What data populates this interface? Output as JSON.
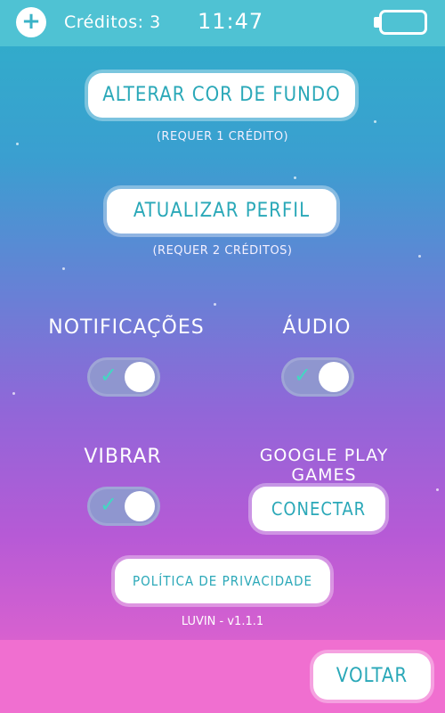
{
  "status_bar": {
    "credits_text": "Créditos: 3",
    "time": "11:47",
    "battery_icon": "battery-icon",
    "add_icon": "plus-icon"
  },
  "buttons": {
    "change_bg_label": "ALTERAR COR DE FUNDO",
    "change_bg_note": "(REQUER 1 CRÉDITO)",
    "update_profile_label": "ATUALIZAR PERFIL",
    "update_profile_note": "(REQUER 2 CRÉDITOS)",
    "connect_label": "CONECTAR",
    "privacy_label": "POLÍTICA DE PRIVACIDADE",
    "back_label": "VOLTAR"
  },
  "settings": {
    "notifications_label": "NOTIFICAÇÕES",
    "audio_label": "ÁUDIO",
    "vibrate_label": "VIBRAR",
    "google_play_label": "GOOGLE PLAY GAMES",
    "notifications_on": true,
    "audio_on": true,
    "vibrate_on": true
  },
  "version": "LUVIN - v1.1.1",
  "colors": {
    "accent": "#2aa8b8",
    "toggle_check": "#43d7c2",
    "top_bar": "#4fc2d3",
    "footer": "#f06fd0"
  }
}
